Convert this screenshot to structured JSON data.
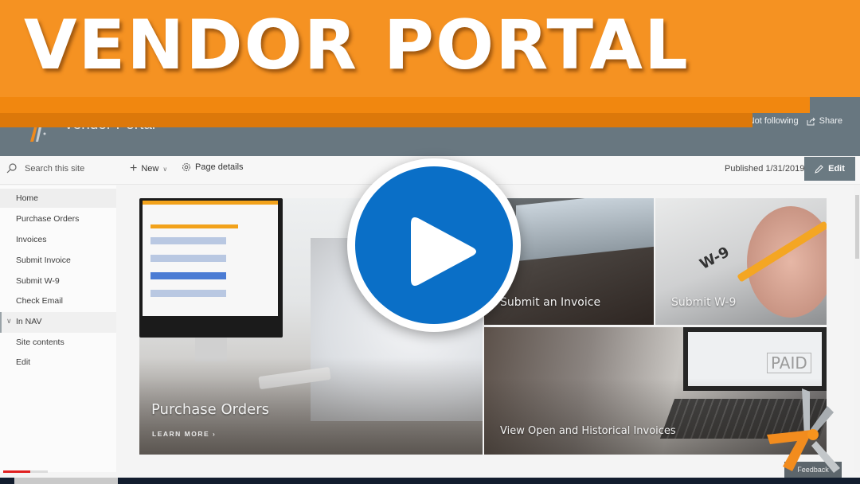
{
  "banner": {
    "title": "VENDOR PORTAL",
    "color": "#f59222"
  },
  "site": {
    "title": "Vendor Portal",
    "follow_label": "Not following",
    "share_label": "Share",
    "header_color": "#687780"
  },
  "commandbar": {
    "search_placeholder": "Search this site",
    "new_label": "New",
    "page_details_label": "Page details",
    "published_label": "Published 1/31/2019",
    "edit_label": "Edit"
  },
  "leftnav": {
    "items": [
      {
        "label": "Home",
        "selected": true
      },
      {
        "label": "Purchase Orders"
      },
      {
        "label": "Invoices"
      },
      {
        "label": "Submit Invoice"
      },
      {
        "label": "Submit W-9"
      },
      {
        "label": "Check Email"
      },
      {
        "label": "In NAV",
        "group": true,
        "expanded": true
      },
      {
        "label": "Site contents"
      },
      {
        "label": "Edit"
      }
    ]
  },
  "hero": {
    "tiles": [
      {
        "label": "Purchase Orders",
        "link": "LEARN MORE"
      },
      {
        "label": "Submit an Invoice"
      },
      {
        "label": "Submit W-9"
      },
      {
        "label": "View Open and Historical Invoices"
      }
    ],
    "w9_text": "W-9",
    "paid_text": "PAID"
  },
  "video": {
    "play_color": "#0a6fc7",
    "progress_fraction": 0.6,
    "progress_color": "#e02020"
  },
  "feedback_label": "Feedback"
}
